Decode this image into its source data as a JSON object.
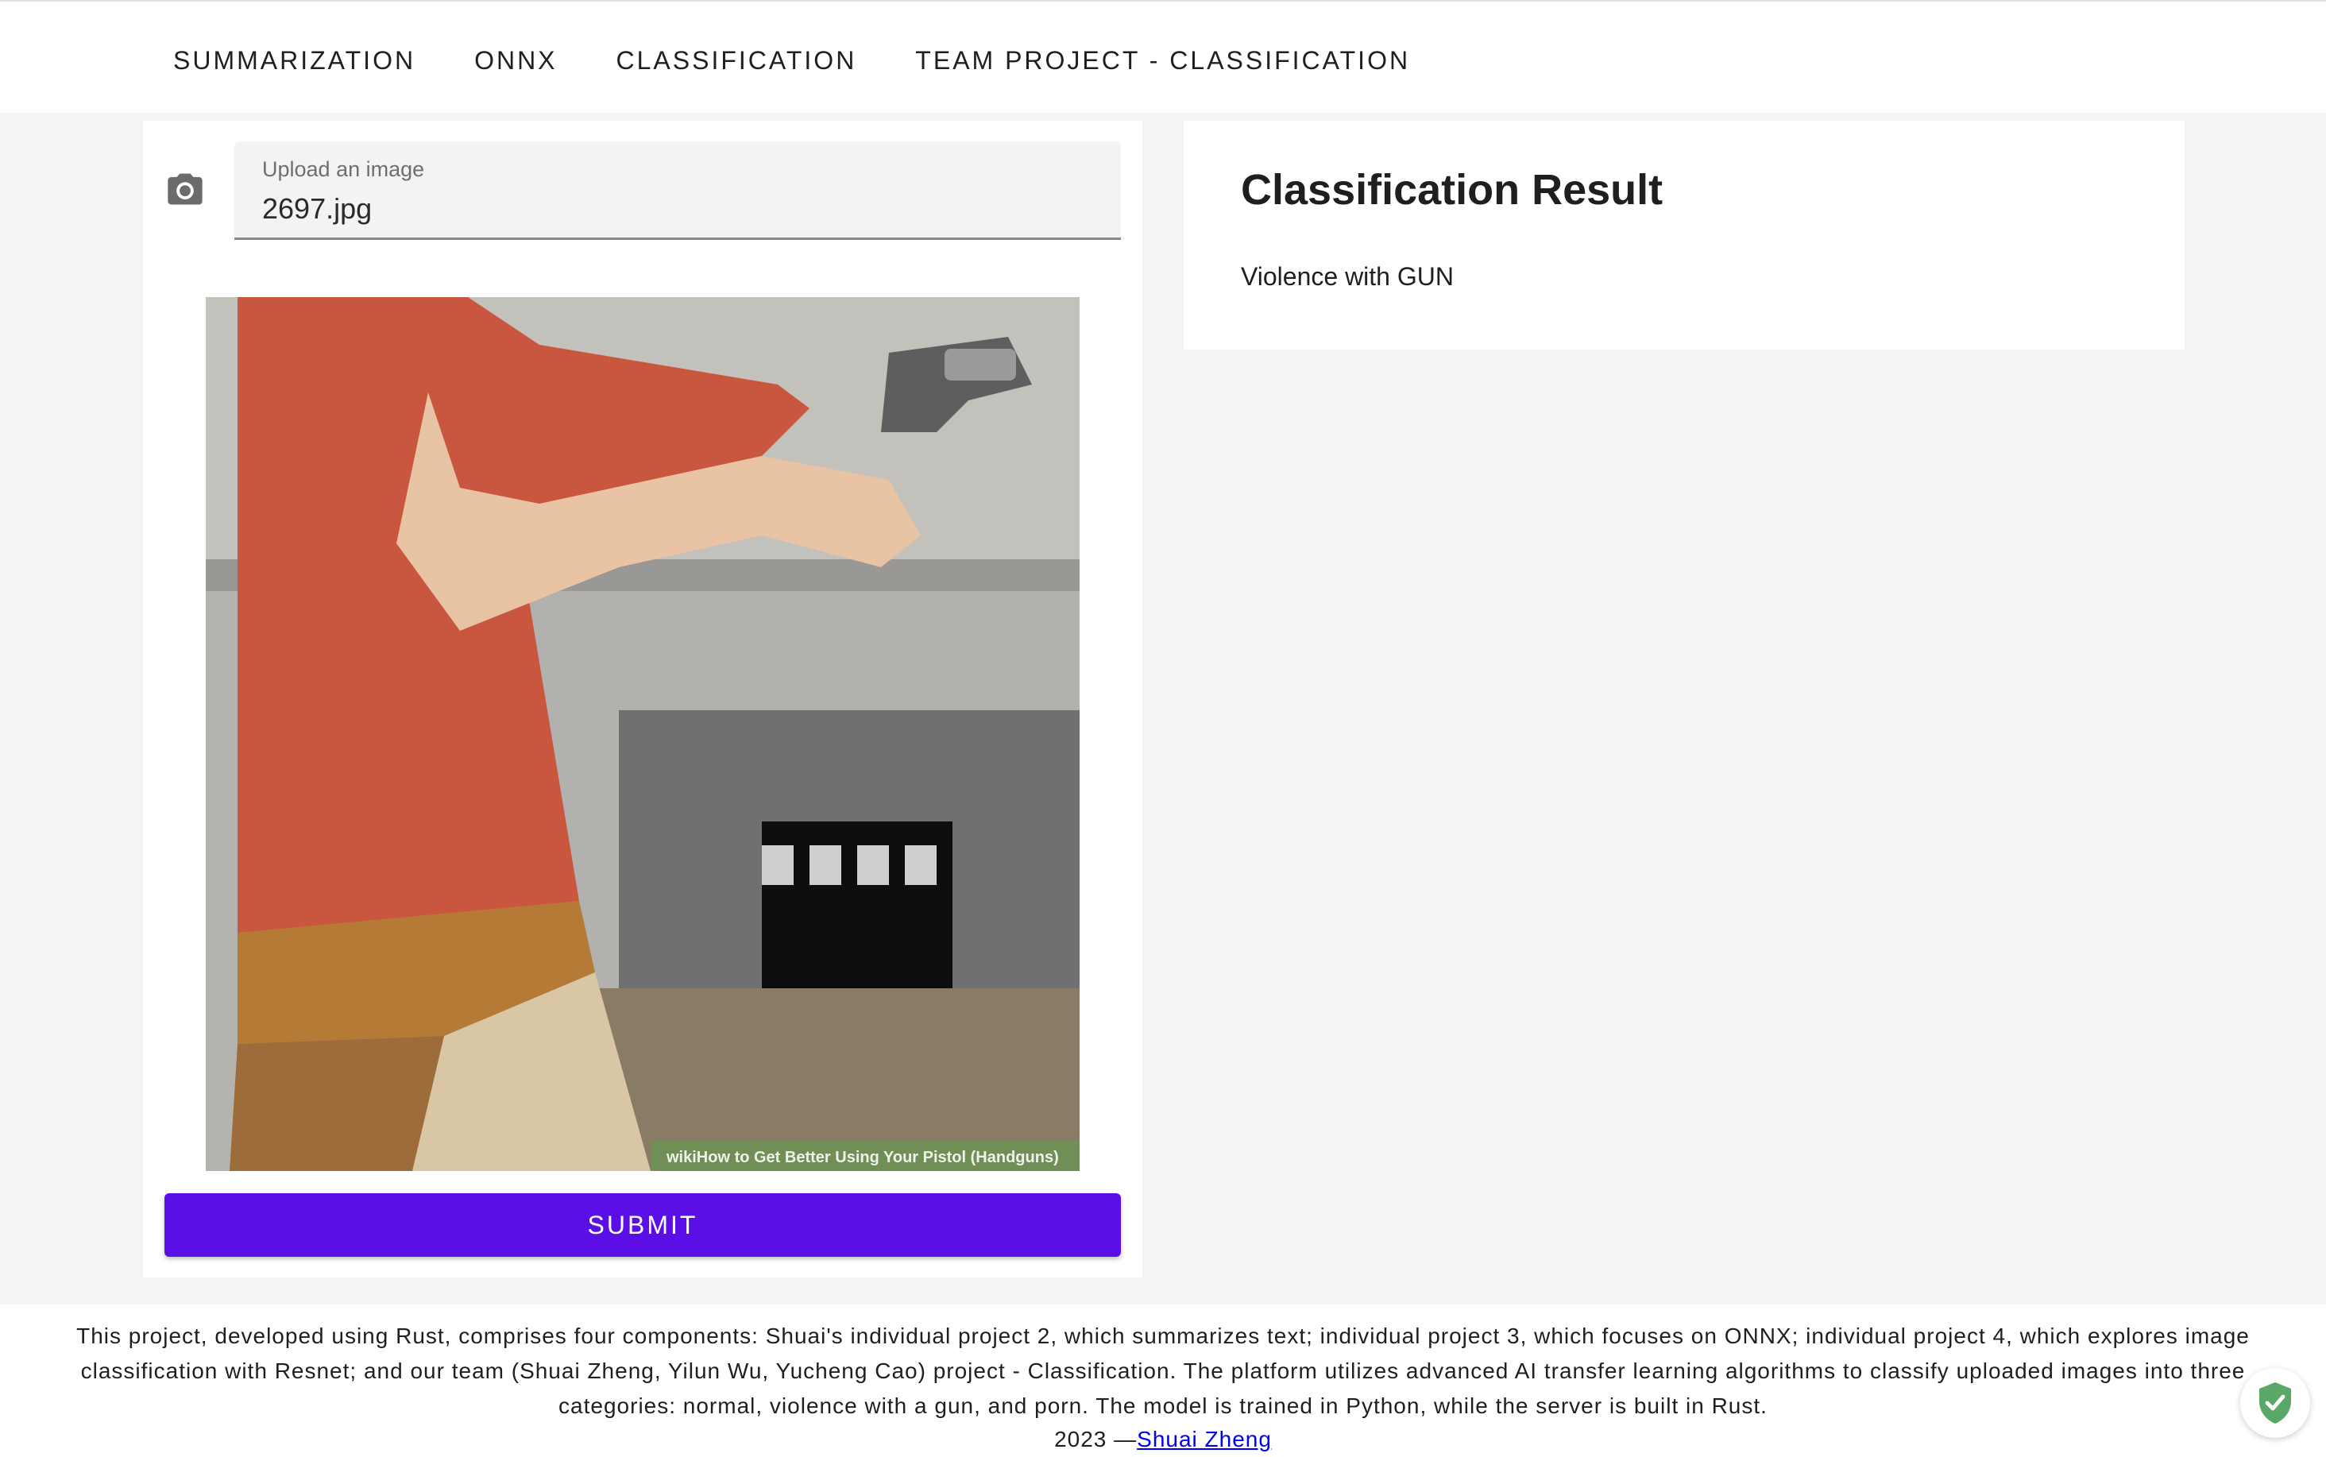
{
  "nav": {
    "items": [
      {
        "label": "SUMMARIZATION"
      },
      {
        "label": "ONNX"
      },
      {
        "label": "CLASSIFICATION"
      },
      {
        "label": "TEAM PROJECT - CLASSIFICATION"
      }
    ]
  },
  "upload": {
    "icon": "camera-icon",
    "label": "Upload an image",
    "value": "2697.jpg"
  },
  "preview": {
    "watermark": "wikiHow to Get Better Using Your Pistol (Handguns)"
  },
  "submit": {
    "label": "SUBMIT"
  },
  "result": {
    "title": "Classification Result",
    "text": "Violence with GUN"
  },
  "footer": {
    "description": "This project, developed using Rust, comprises four components: Shuai's individual project 2, which summarizes text; individual project 3, which focuses on ONNX; individual project 4, which explores image classification with Resnet; and our team (Shuai Zheng, Yilun Wu, Yucheng Cao) project - Classification. The platform utilizes advanced AI transfer learning algorithms to classify uploaded images into three categories: normal, violence with a gun, and porn. The model is trained in Python, while the server is built in Rust.",
    "year": "2023 —",
    "author": "Shuai Zheng"
  },
  "colors": {
    "accent": "#5b0fe6",
    "link": "#0000ee",
    "background": "#f4f4f4"
  },
  "badge": {
    "icon": "shield-check-icon"
  }
}
